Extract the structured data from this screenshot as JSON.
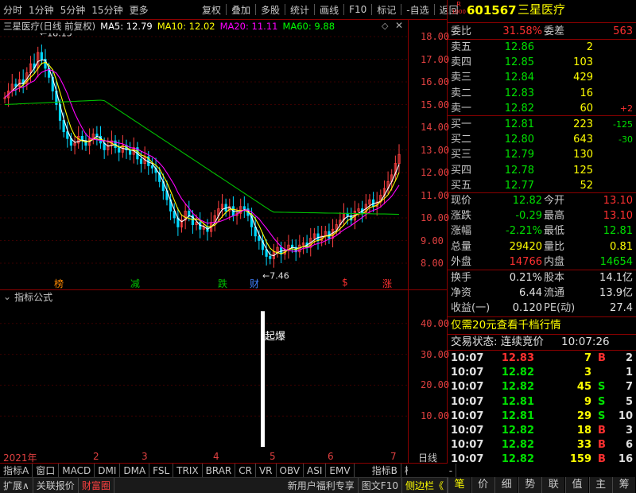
{
  "toolbar": {
    "left": [
      "分时",
      "1分钟",
      "5分钟",
      "15分钟",
      "更多"
    ],
    "right": [
      "复权",
      "叠加",
      "多股",
      "统计",
      "画线",
      "F10",
      "标记",
      "-自选",
      "返回"
    ]
  },
  "chart_header": {
    "title": "三星医疗(日线 前复权)",
    "ma5": "MA5: 12.79",
    "ma10": "MA10: 12.02",
    "ma20": "MA20: 11.11",
    "ma60": "MA60: 9.88"
  },
  "chart_data": {
    "type": "candlestick",
    "price_axis": [
      "18.00",
      "17.00",
      "16.00",
      "15.00",
      "14.00",
      "13.00",
      "12.00",
      "11.00",
      "10.00",
      "9.00",
      "8.00"
    ],
    "max_label": "18.15",
    "min_label": "7.46",
    "markers": [
      {
        "text": "榜",
        "color": "#ff8800"
      },
      {
        "text": "减",
        "color": "#00c000"
      },
      {
        "text": "跌",
        "color": "#00c000"
      },
      {
        "text": "财",
        "color": "#4080ff"
      },
      {
        "text": "$",
        "color": "#ff3030"
      },
      {
        "text": "涨",
        "color": "#ff3030"
      }
    ],
    "indicator_axis": [
      "40.00",
      "30.00",
      "20.00",
      "10.00"
    ],
    "indicator_bar_value": 44,
    "x_labels": [
      "2021年",
      "2",
      "3",
      "4",
      "5",
      "6",
      "7"
    ],
    "x_label_right": "日线"
  },
  "indicator": {
    "title": "指标公式",
    "annotation": "起爆"
  },
  "tabs": [
    "指标A",
    "窗口",
    "MACD",
    "DMI",
    "DMA",
    "FSL",
    "TRIX",
    "BRAR",
    "CR",
    "VR",
    "OBV",
    "ASI",
    "EMV",
    "指标B",
    "模 板",
    "+",
    "-"
  ],
  "status_tabs": {
    "left": [
      "扩展∧",
      "关联报价",
      "财富圈"
    ],
    "right": [
      "新用户福利专享",
      "图文F10",
      "侧边栏《"
    ]
  },
  "stock": {
    "code": "601567",
    "name": "三星医疗",
    "badge_top": "R",
    "badge_bottom": "1000"
  },
  "weibi": {
    "label1": "委比",
    "value1": "31.58%",
    "label2": "委差",
    "value2": "563"
  },
  "sells": [
    {
      "label": "卖五",
      "price": "12.86",
      "vol": "2",
      "chg": ""
    },
    {
      "label": "卖四",
      "price": "12.85",
      "vol": "103",
      "chg": ""
    },
    {
      "label": "卖三",
      "price": "12.84",
      "vol": "429",
      "chg": ""
    },
    {
      "label": "卖二",
      "price": "12.83",
      "vol": "16",
      "chg": ""
    },
    {
      "label": "卖一",
      "price": "12.82",
      "vol": "60",
      "chg": "+2"
    }
  ],
  "buys": [
    {
      "label": "买一",
      "price": "12.81",
      "vol": "223",
      "chg": "-125"
    },
    {
      "label": "买二",
      "price": "12.80",
      "vol": "643",
      "chg": "-30"
    },
    {
      "label": "买三",
      "price": "12.79",
      "vol": "130",
      "chg": ""
    },
    {
      "label": "买四",
      "price": "12.78",
      "vol": "125",
      "chg": ""
    },
    {
      "label": "买五",
      "price": "12.77",
      "vol": "52",
      "chg": ""
    }
  ],
  "stats": [
    {
      "l1": "现价",
      "v1": "12.82",
      "c1": "green",
      "l2": "今开",
      "v2": "13.10",
      "c2": "red"
    },
    {
      "l1": "涨跌",
      "v1": "-0.29",
      "c1": "green",
      "l2": "最高",
      "v2": "13.10",
      "c2": "red"
    },
    {
      "l1": "涨幅",
      "v1": "-2.21%",
      "c1": "green",
      "l2": "最低",
      "v2": "12.81",
      "c2": "green"
    },
    {
      "l1": "总量",
      "v1": "29420",
      "c1": "yellow",
      "l2": "量比",
      "v2": "0.81",
      "c2": "yellow"
    },
    {
      "l1": "外盘",
      "v1": "14766",
      "c1": "red",
      "l2": "内盘",
      "v2": "14654",
      "c2": "green"
    }
  ],
  "stats2": [
    {
      "l1": "换手",
      "v1": "0.21%",
      "l2": "股本",
      "v2": "14.1亿"
    },
    {
      "l1": "净资",
      "v1": "6.44",
      "l2": "流通",
      "v2": "13.9亿"
    },
    {
      "l1": "收益(一)",
      "v1": "0.120",
      "l2": "PE(动)",
      "v2": "27.4"
    }
  ],
  "promo": "仅需20元查看千档行情",
  "trade_status": {
    "label": "交易状态: 连续竞价",
    "time": "10:07:26"
  },
  "ticks": [
    {
      "time": "10:07",
      "price": "12.83",
      "pc": "red",
      "vol": "7",
      "bs": "B",
      "n": "2"
    },
    {
      "time": "10:07",
      "price": "12.82",
      "pc": "green",
      "vol": "3",
      "bs": "",
      "n": "1"
    },
    {
      "time": "10:07",
      "price": "12.82",
      "pc": "green",
      "vol": "45",
      "bs": "S",
      "n": "7"
    },
    {
      "time": "10:07",
      "price": "12.81",
      "pc": "green",
      "vol": "9",
      "bs": "S",
      "n": "5"
    },
    {
      "time": "10:07",
      "price": "12.81",
      "pc": "green",
      "vol": "29",
      "bs": "S",
      "n": "10"
    },
    {
      "time": "10:07",
      "price": "12.82",
      "pc": "green",
      "vol": "18",
      "bs": "B",
      "n": "3"
    },
    {
      "time": "10:07",
      "price": "12.82",
      "pc": "green",
      "vol": "33",
      "bs": "B",
      "n": "6"
    },
    {
      "time": "10:07",
      "price": "12.82",
      "pc": "green",
      "vol": "159",
      "bs": "B",
      "n": "16"
    }
  ],
  "side_tabs": [
    "笔",
    "价",
    "细",
    "势",
    "联",
    "值",
    "主",
    "筹"
  ]
}
